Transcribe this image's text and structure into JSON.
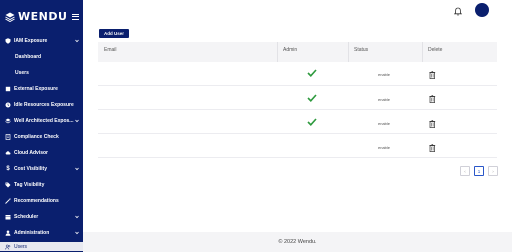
{
  "brand": {
    "name": "WENDU"
  },
  "sidebar": {
    "items": [
      {
        "label": "IAM Exposure",
        "icon": "shield-icon",
        "expandable": true
      },
      {
        "label": "Dashboard",
        "sub": true
      },
      {
        "label": "Users",
        "sub": true
      },
      {
        "label": "External Exposure",
        "icon": "cube-icon"
      },
      {
        "label": "Idle Resources Exposure",
        "icon": "clock-icon"
      },
      {
        "label": "Well Architected Expos...",
        "icon": "layers-icon",
        "expandable": true
      },
      {
        "label": "Compliance Check",
        "icon": "checklist-icon"
      },
      {
        "label": "Cloud Advisor",
        "icon": "cloud-icon"
      },
      {
        "label": "Cost Visibility",
        "icon": "dollar-icon",
        "expandable": true
      },
      {
        "label": "Tag Visibility",
        "icon": "tag-icon"
      },
      {
        "label": "Recommendations",
        "icon": "wand-icon"
      },
      {
        "label": "Scheduler",
        "icon": "calendar-icon",
        "expandable": true
      },
      {
        "label": "Administration",
        "icon": "user-icon",
        "expandable": true
      },
      {
        "label": "Users",
        "icon": "users-icon",
        "active": true
      }
    ]
  },
  "toolbar": {
    "add_user_label": "Add User"
  },
  "table": {
    "headers": [
      "Email",
      "Admin",
      "Status",
      "Delete"
    ],
    "rows": [
      {
        "email": "",
        "admin": true,
        "status": "enable"
      },
      {
        "email": "",
        "admin": true,
        "status": "enable"
      },
      {
        "email": "",
        "admin": true,
        "status": "enable"
      },
      {
        "email": "",
        "admin": false,
        "status": "enable"
      }
    ]
  },
  "pagination": {
    "prev": "‹",
    "current": "1",
    "next": "›"
  },
  "footer": {
    "text": "© 2022 Wendu."
  },
  "colors": {
    "sidebar": "#0a1f6e",
    "check": "#2e9a3e",
    "accent": "#2a57c9"
  }
}
